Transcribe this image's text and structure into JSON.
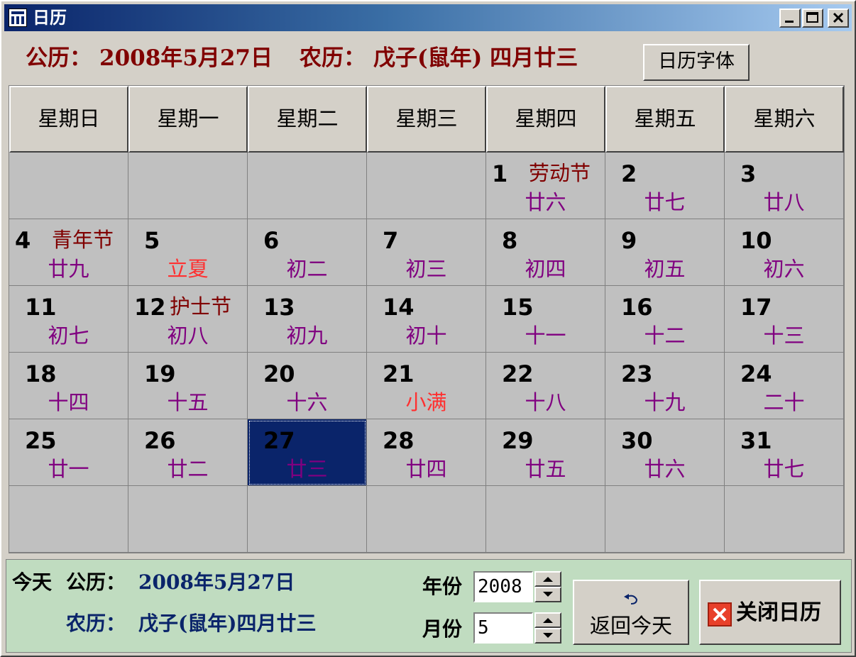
{
  "window": {
    "title": "日历"
  },
  "header": {
    "solar_label": "公历：",
    "solar_value": "2008年5月27日",
    "lunar_label": "农历：",
    "lunar_value": "戊子(鼠年) 四月廿三",
    "font_button": "日历字体"
  },
  "weekdays": [
    "星期日",
    "星期一",
    "星期二",
    "星期三",
    "星期四",
    "星期五",
    "星期六"
  ],
  "cells": [
    {
      "day": "",
      "holiday": "",
      "lunar": ""
    },
    {
      "day": "",
      "holiday": "",
      "lunar": ""
    },
    {
      "day": "",
      "holiday": "",
      "lunar": ""
    },
    {
      "day": "",
      "holiday": "",
      "lunar": ""
    },
    {
      "day": "1",
      "holiday": "劳动节",
      "lunar": "廿六"
    },
    {
      "day": "2",
      "holiday": "",
      "lunar": "廿七"
    },
    {
      "day": "3",
      "holiday": "",
      "lunar": "廿八"
    },
    {
      "day": "4",
      "holiday": "青年节",
      "lunar": "廿九"
    },
    {
      "day": "5",
      "holiday": "",
      "lunar": "立夏",
      "term": true
    },
    {
      "day": "6",
      "holiday": "",
      "lunar": "初二"
    },
    {
      "day": "7",
      "holiday": "",
      "lunar": "初三"
    },
    {
      "day": "8",
      "holiday": "",
      "lunar": "初四"
    },
    {
      "day": "9",
      "holiday": "",
      "lunar": "初五"
    },
    {
      "day": "10",
      "holiday": "",
      "lunar": "初六"
    },
    {
      "day": "11",
      "holiday": "",
      "lunar": "初七"
    },
    {
      "day": "12",
      "holiday": "护士节",
      "lunar": "初八"
    },
    {
      "day": "13",
      "holiday": "",
      "lunar": "初九"
    },
    {
      "day": "14",
      "holiday": "",
      "lunar": "初十"
    },
    {
      "day": "15",
      "holiday": "",
      "lunar": "十一"
    },
    {
      "day": "16",
      "holiday": "",
      "lunar": "十二"
    },
    {
      "day": "17",
      "holiday": "",
      "lunar": "十三"
    },
    {
      "day": "18",
      "holiday": "",
      "lunar": "十四"
    },
    {
      "day": "19",
      "holiday": "",
      "lunar": "十五"
    },
    {
      "day": "20",
      "holiday": "",
      "lunar": "十六"
    },
    {
      "day": "21",
      "holiday": "",
      "lunar": "小满",
      "term": true
    },
    {
      "day": "22",
      "holiday": "",
      "lunar": "十八"
    },
    {
      "day": "23",
      "holiday": "",
      "lunar": "十九"
    },
    {
      "day": "24",
      "holiday": "",
      "lunar": "二十"
    },
    {
      "day": "25",
      "holiday": "",
      "lunar": "廿一"
    },
    {
      "day": "26",
      "holiday": "",
      "lunar": "廿二"
    },
    {
      "day": "27",
      "holiday": "",
      "lunar": "廿三",
      "selected": true
    },
    {
      "day": "28",
      "holiday": "",
      "lunar": "廿四"
    },
    {
      "day": "29",
      "holiday": "",
      "lunar": "廿五"
    },
    {
      "day": "30",
      "holiday": "",
      "lunar": "廿六"
    },
    {
      "day": "31",
      "holiday": "",
      "lunar": "廿七"
    },
    {
      "day": "",
      "holiday": "",
      "lunar": ""
    },
    {
      "day": "",
      "holiday": "",
      "lunar": ""
    },
    {
      "day": "",
      "holiday": "",
      "lunar": ""
    },
    {
      "day": "",
      "holiday": "",
      "lunar": ""
    },
    {
      "day": "",
      "holiday": "",
      "lunar": ""
    },
    {
      "day": "",
      "holiday": "",
      "lunar": ""
    },
    {
      "day": "",
      "holiday": "",
      "lunar": ""
    }
  ],
  "footer": {
    "today_label": "今天",
    "solar_label": "公历：",
    "solar_value": "2008年5月27日",
    "lunar_label": "农历：",
    "lunar_value": "戊子(鼠年)四月廿三",
    "year_label": "年份",
    "year_value": "2008",
    "month_label": "月份",
    "month_value": "5",
    "return_today": "返回今天",
    "close_calendar": "关闭日历"
  },
  "colors": {
    "title_gradient_start": "#0a246a",
    "header_text": "#800000",
    "lunar_text": "#800080",
    "solar_term_text": "#ff3030",
    "selected_cell": "#0a246a",
    "footer_bg": "#c0dcc0",
    "footer_text": "#0a246a"
  },
  "icons": {
    "app": "calendar-icon",
    "minimize": "minimize-icon",
    "maximize": "maximize-icon",
    "close": "close-icon",
    "return": "undo-arrow-icon",
    "close_calendar": "red-x-icon"
  }
}
